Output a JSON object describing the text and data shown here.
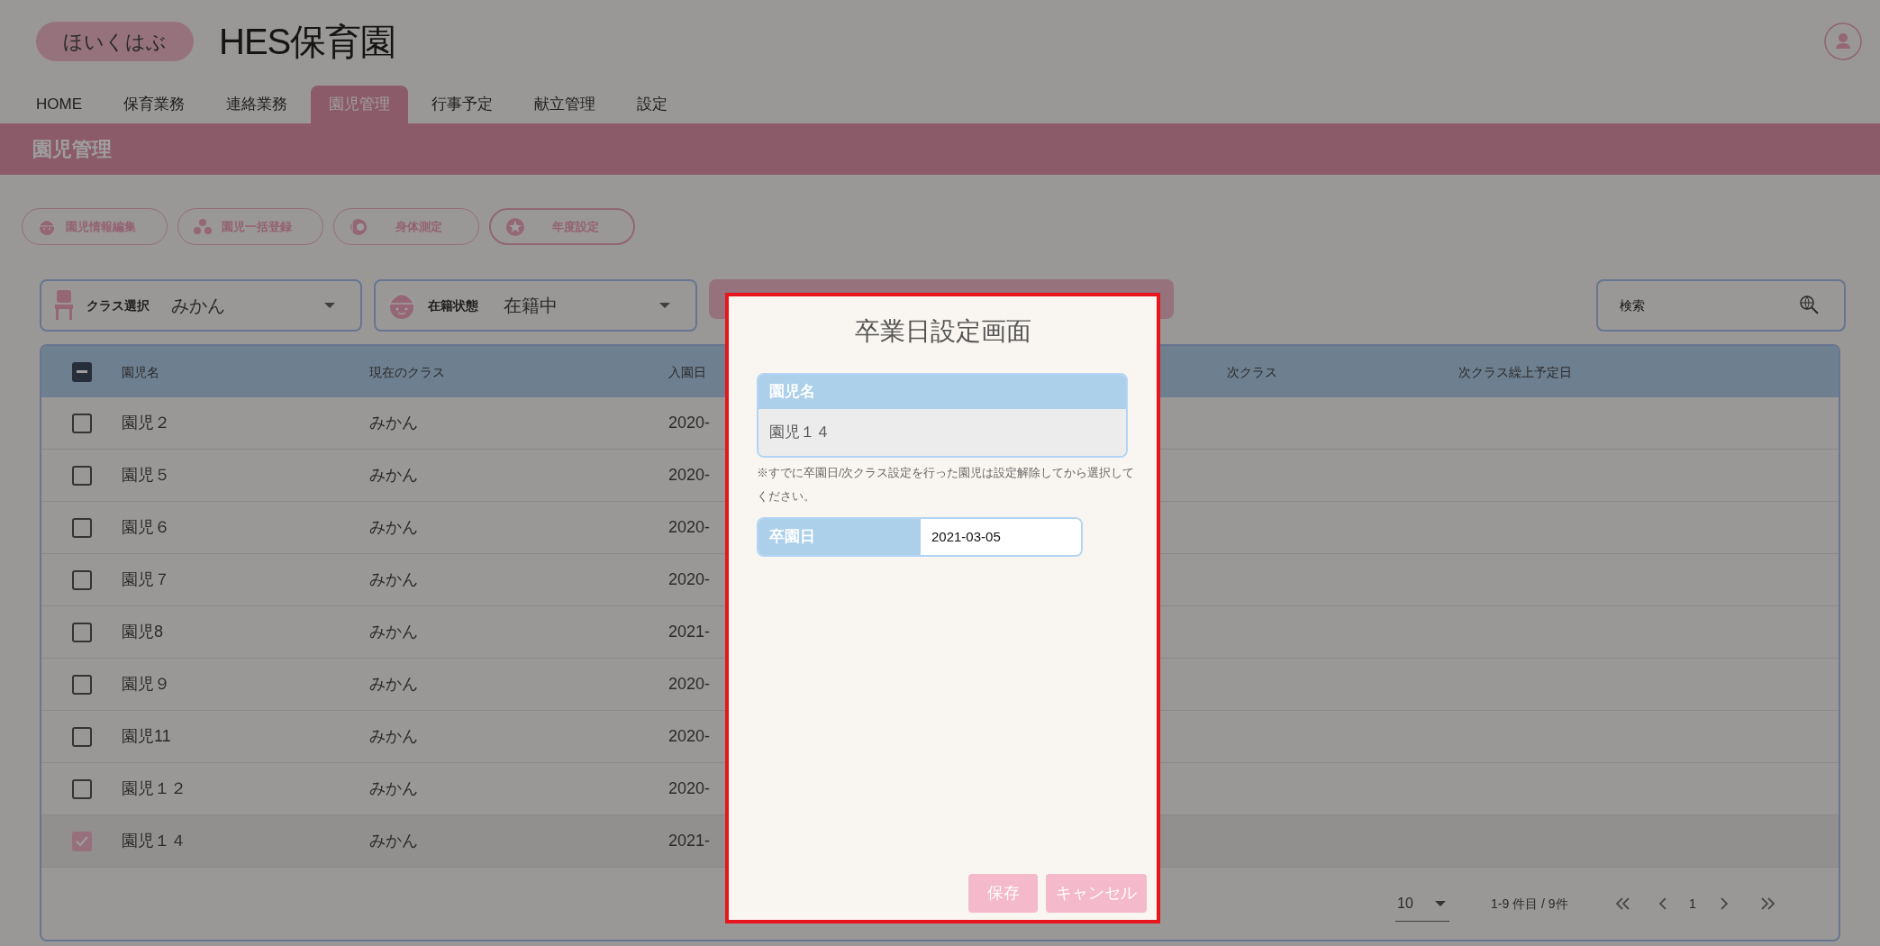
{
  "header": {
    "logo_text": "ほいくはぶ",
    "title": "HES保育園"
  },
  "nav_tabs": [
    {
      "label": "HOME",
      "selected": false
    },
    {
      "label": "保育業務",
      "selected": false
    },
    {
      "label": "連絡業務",
      "selected": false
    },
    {
      "label": "園児管理",
      "selected": true
    },
    {
      "label": "行事予定",
      "selected": false
    },
    {
      "label": "献立管理",
      "selected": false
    },
    {
      "label": "設定",
      "selected": false
    }
  ],
  "page_title": "園児管理",
  "action_buttons": [
    {
      "label": "園児情報編集",
      "kind": "face",
      "selected": false
    },
    {
      "label": "園児一括登録",
      "kind": "group",
      "selected": false
    },
    {
      "label": "身体測定",
      "kind": "measure",
      "selected": false
    },
    {
      "label": "年度設定",
      "kind": "star",
      "selected": true
    }
  ],
  "filters": {
    "class_select": {
      "label": "クラス選択",
      "value": "みかん"
    },
    "status_select": {
      "label": "在籍状態",
      "value": "在籍中"
    },
    "search": {
      "placeholder": "検索"
    }
  },
  "table": {
    "select_all_indeterminate": true,
    "columns": [
      "園児名",
      "現在のクラス",
      "入園日",
      "次クラス",
      "次クラス繰上予定日"
    ],
    "rows": [
      {
        "name": "園児２",
        "class": "みかん",
        "enrolled": "2020-",
        "checked": false
      },
      {
        "name": "園児５",
        "class": "みかん",
        "enrolled": "2020-",
        "checked": false
      },
      {
        "name": "園児６",
        "class": "みかん",
        "enrolled": "2020-",
        "checked": false
      },
      {
        "name": "園児７",
        "class": "みかん",
        "enrolled": "2020-",
        "checked": false
      },
      {
        "name": "園児8",
        "class": "みかん",
        "enrolled": "2021-",
        "checked": false
      },
      {
        "name": "園児９",
        "class": "みかん",
        "enrolled": "2020-",
        "checked": false
      },
      {
        "name": "園児11",
        "class": "みかん",
        "enrolled": "2020-",
        "checked": false
      },
      {
        "name": "園児１２",
        "class": "みかん",
        "enrolled": "2020-",
        "checked": false
      },
      {
        "name": "園児１４",
        "class": "みかん",
        "enrolled": "2021-",
        "checked": true
      }
    ]
  },
  "pagination": {
    "per_page": "10",
    "range": "1-9 件目 / 9件",
    "page": "1"
  },
  "dialog": {
    "title": "卒業日設定画面",
    "name_label": "園児名",
    "name_value": "園児１４",
    "note": "※すでに卒園日/次クラス設定を行った園児は設定解除してから選択してください。",
    "date_label": "卒園日",
    "date_value": "2021-03-05",
    "buttons": [
      "保存",
      "キャンセル"
    ]
  }
}
